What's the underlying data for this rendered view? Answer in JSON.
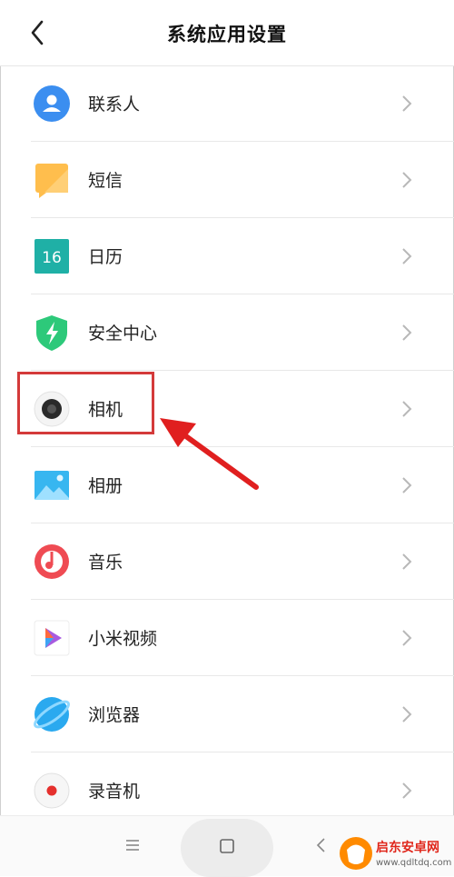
{
  "header": {
    "title": "系统应用设置",
    "back_icon": "chevron-left-icon"
  },
  "items": [
    {
      "label": "联系人",
      "icon": "contacts-icon",
      "color": "#3b8ef0"
    },
    {
      "label": "短信",
      "icon": "messages-icon",
      "color": "#ffbe4d"
    },
    {
      "label": "日历",
      "icon": "calendar-icon",
      "color": "#1fb0a6",
      "icon_text": "16"
    },
    {
      "label": "安全中心",
      "icon": "security-shield-icon",
      "color": "#2dc97a"
    },
    {
      "label": "相机",
      "icon": "camera-icon",
      "color": "#222222",
      "highlighted": true
    },
    {
      "label": "相册",
      "icon": "gallery-icon",
      "color": "#37b6f0"
    },
    {
      "label": "音乐",
      "icon": "music-icon",
      "color": "#ef4b53"
    },
    {
      "label": "小米视频",
      "icon": "video-icon",
      "color": "#a85be0"
    },
    {
      "label": "浏览器",
      "icon": "browser-icon",
      "color": "#2aa9ef"
    },
    {
      "label": "录音机",
      "icon": "recorder-icon",
      "color": "#e5302d"
    }
  ],
  "annotation": {
    "highlight_color": "#d43a3a",
    "arrow_color": "#e01f1f"
  },
  "navbar": {
    "menu_icon": "menu-icon",
    "home_icon": "home-square-icon",
    "back_icon": "back-icon"
  },
  "watermark": {
    "text": "启东安卓网",
    "url": "www.qdltdq.com"
  }
}
